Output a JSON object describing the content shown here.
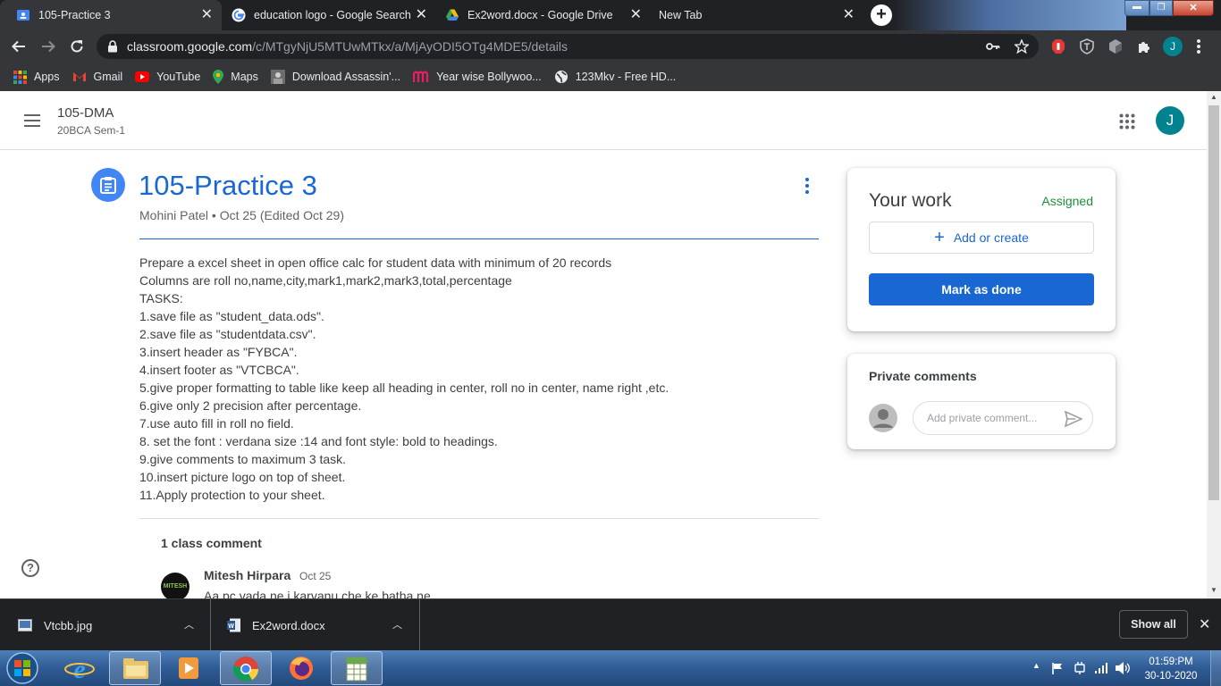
{
  "browser": {
    "tabs": [
      {
        "title": "105-Practice 3",
        "active": true
      },
      {
        "title": "education logo - Google Search",
        "active": false
      },
      {
        "title": "Ex2word.docx - Google Drive",
        "active": false
      },
      {
        "title": "New Tab",
        "active": false
      }
    ],
    "new_tab_symbol": "+",
    "url_domain": "classroom.google.com",
    "url_path": "/c/MTgyNjU5MTUwMTkx/a/MjAyODI5OTg4MDE5/details",
    "profile_initial": "J",
    "bookmarks": [
      {
        "label": "Apps",
        "icon": "apps-grid-icon"
      },
      {
        "label": "Gmail",
        "icon": "gmail-icon"
      },
      {
        "label": "YouTube",
        "icon": "youtube-icon"
      },
      {
        "label": "Maps",
        "icon": "maps-pin-icon"
      },
      {
        "label": "Download Assassin'...",
        "icon": "thumbnail-icon"
      },
      {
        "label": "Year wise Bollywoo...",
        "icon": "m-logo-icon"
      },
      {
        "label": "123Mkv - Free HD...",
        "icon": "globe-icon"
      }
    ]
  },
  "classroom": {
    "class_name": "105-DMA",
    "class_section": "20BCA Sem-1",
    "avatar_initial": "J",
    "assignment": {
      "title": "105-Practice 3",
      "meta": "Mohini Patel • Oct 25 (Edited Oct 29)",
      "description": [
        "Prepare a excel sheet in open office calc for student data with minimum of 20 records",
        "Columns are roll no,name,city,mark1,mark2,mark3,total,percentage",
        "TASKS:",
        "1.save file as \"student_data.ods\".",
        "2.save file as \"studentdata.csv\".",
        "3.insert header as \"FYBCA\".",
        "4.insert footer as \"VTCBCA\".",
        "5.give proper formatting to table like keep all heading in center, roll no in center, name right ,etc.",
        "6.give only 2 precision after percentage.",
        "7.use auto fill in roll no field.",
        "8. set the font : verdana size :14 and font style: bold to headings.",
        "9.give comments to maximum 3 task.",
        "10.insert picture logo on top of sheet.",
        "11.Apply protection to your sheet."
      ]
    },
    "class_comments": {
      "count_label": "1 class comment",
      "comment": {
        "author": "Mitesh Hirpara",
        "date": "Oct 25",
        "text": "Aa pc vada ne j karvanu che ke batha ne",
        "avatar_text": "MITESH"
      }
    },
    "your_work": {
      "heading": "Your work",
      "status": "Assigned",
      "add_label": "Add or create",
      "mark_done_label": "Mark as done"
    },
    "private_comments": {
      "heading": "Private comments",
      "placeholder": "Add private comment..."
    },
    "help_symbol": "?"
  },
  "downloads": {
    "items": [
      {
        "name": "Vtcbb.jpg"
      },
      {
        "name": "Ex2word.docx"
      }
    ],
    "show_all_label": "Show all"
  },
  "taskbar": {
    "time": "01:59:PM",
    "date": "30-10-2020"
  },
  "colors": {
    "accent_blue": "#1967d2",
    "assigned_green": "#1e8e3e",
    "avatar_teal": "#00838f",
    "chrome_dark": "#202124",
    "chrome_toolbar": "#35363a"
  }
}
